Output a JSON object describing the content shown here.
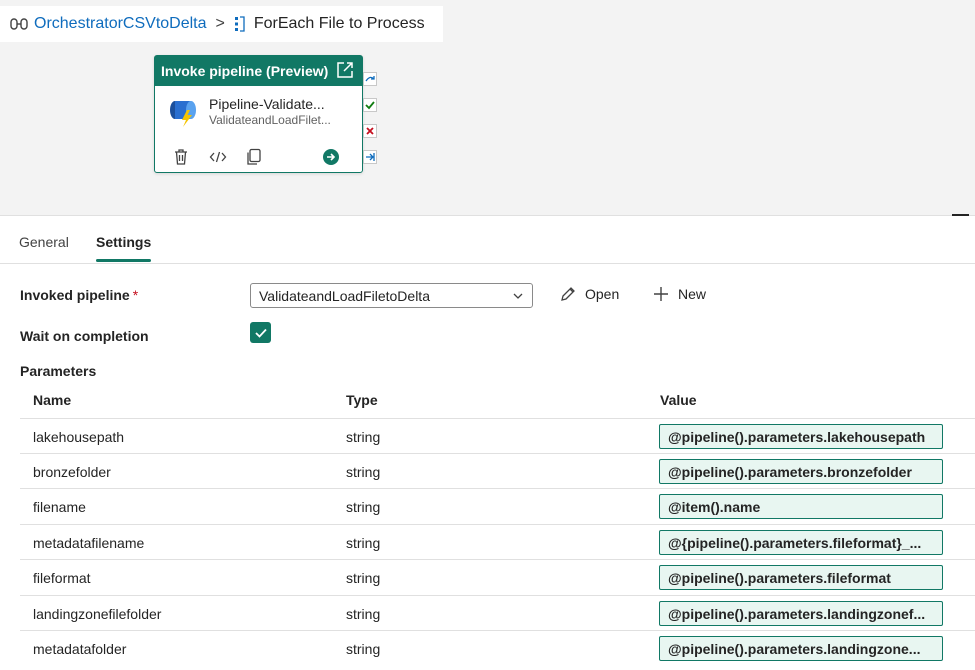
{
  "breadcrumb": {
    "pipeline": "OrchestratorCSVtoDelta",
    "separator": ">",
    "activity": "ForEach File to Process"
  },
  "activity": {
    "header": "Invoke pipeline (Preview)",
    "name": "Pipeline-Validate...",
    "sub": "ValidateandLoadFilet..."
  },
  "tabs": [
    "General",
    "Settings"
  ],
  "settings": {
    "invoked_label": "Invoked pipeline",
    "required_mark": "*",
    "invoked_value": "ValidateandLoadFiletoDelta",
    "open_label": "Open",
    "new_label": "New",
    "wait_label": "Wait on completion",
    "wait_checked": true,
    "params_label": "Parameters"
  },
  "table": {
    "headers": [
      "Name",
      "Type",
      "Value"
    ],
    "rows": [
      {
        "name": "lakehousepath",
        "type": "string",
        "value": "@pipeline().parameters.lakehousepath"
      },
      {
        "name": "bronzefolder",
        "type": "string",
        "value": "@pipeline().parameters.bronzefolder"
      },
      {
        "name": "filename",
        "type": "string",
        "value": "@item().name"
      },
      {
        "name": "metadatafilename",
        "type": "string",
        "value": "@{pipeline().parameters.fileformat}_..."
      },
      {
        "name": "fileformat",
        "type": "string",
        "value": "@pipeline().parameters.fileformat"
      },
      {
        "name": "landingzonefilefolder",
        "type": "string",
        "value": "@pipeline().parameters.landingzonef..."
      },
      {
        "name": "metadatafolder",
        "type": "string",
        "value": "@pipeline().parameters.landingzone..."
      }
    ]
  },
  "colors": {
    "accent": "#117865",
    "link": "#0f6cbd",
    "value_bg": "#e8f6f1",
    "fail": "#c50f1f"
  }
}
